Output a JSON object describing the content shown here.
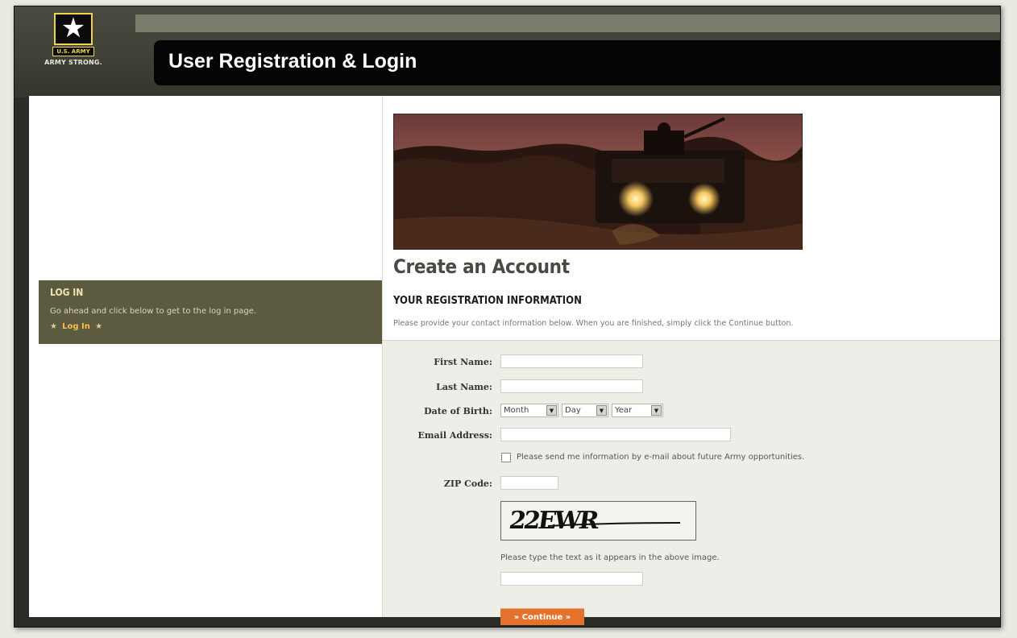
{
  "header": {
    "title": "User Registration & Login",
    "logo_small": "U.S. ARMY",
    "logo_tagline": "ARMY STRONG."
  },
  "login_panel": {
    "heading": "LOG IN",
    "description": "Go ahead and click below to get to the log in page.",
    "link_label": "Log In"
  },
  "main": {
    "title": "Create an Account",
    "section_heading": "YOUR REGISTRATION INFORMATION",
    "instructions": "Please provide your contact information below. When you are finished, simply click the Continue button."
  },
  "form": {
    "first_name_label": "First Name:",
    "last_name_label": "Last Name:",
    "dob_label": "Date of Birth:",
    "dob_month": "Month",
    "dob_day": "Day",
    "dob_year": "Year",
    "email_label": "Email Address:",
    "optin_label": "Please send me information by e-mail about future Army opportunities.",
    "zip_label": "ZIP Code:",
    "captcha_text": "22EWR",
    "captcha_note": "Please type the text as it appears in the above image.",
    "continue_label": "» Continue »"
  },
  "colors": {
    "panel_olive": "#5c5a3f",
    "continue_orange": "#e4722c",
    "header_black": "#050505"
  }
}
